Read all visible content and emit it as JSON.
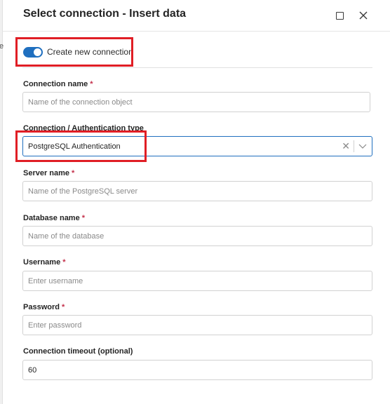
{
  "dialog": {
    "title": "Select connection - Insert data"
  },
  "background": {
    "fragment": "e"
  },
  "toggle": {
    "label": "Create new connection",
    "checked": true,
    "color": "#1f6fbf"
  },
  "fields": {
    "connection_name": {
      "label": "Connection name",
      "required": "*",
      "placeholder": "Name of the connection object",
      "value": ""
    },
    "auth_type": {
      "label": "Connection / Authentication type",
      "value": "PostgreSQL Authentication"
    },
    "server_name": {
      "label": "Server name",
      "required": "*",
      "placeholder": "Name of the PostgreSQL server",
      "value": ""
    },
    "database_name": {
      "label": "Database name",
      "required": "*",
      "placeholder": "Name of the database",
      "value": ""
    },
    "username": {
      "label": "Username",
      "required": "*",
      "placeholder": "Enter username",
      "value": ""
    },
    "password": {
      "label": "Password",
      "required": "*",
      "placeholder": "Enter password",
      "value": ""
    },
    "timeout": {
      "label": "Connection timeout (optional)",
      "value": "60"
    }
  },
  "icons": {
    "maximize": "maximize-icon",
    "close": "close-icon",
    "clear": "clear-icon",
    "chevron": "chevron-down-icon"
  },
  "colors": {
    "accent": "#1f6fbf",
    "required": "#c4314b",
    "highlight": "#e01e25"
  }
}
